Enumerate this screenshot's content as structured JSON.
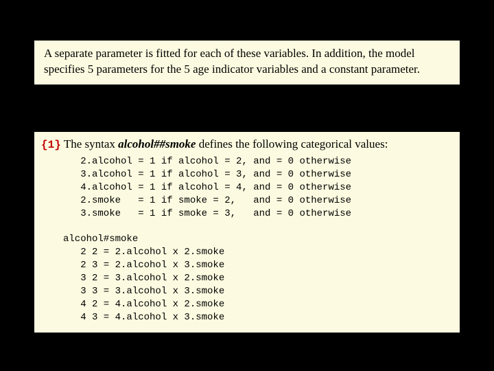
{
  "box1": {
    "text": "A separate parameter is fitted for each of these variables.  In addition, the model specifies 5 parameters for the 5 age indicator variables and a constant parameter."
  },
  "box2": {
    "marker": "{1}",
    "intro_before": "The syntax ",
    "intro_term": "alcohol##smoke",
    "intro_after": " defines the following categorical values:",
    "code": "   2.alcohol = 1 if alcohol = 2, and = 0 otherwise\n   3.alcohol = 1 if alcohol = 3, and = 0 otherwise\n   4.alcohol = 1 if alcohol = 4, and = 0 otherwise\n   2.smoke   = 1 if smoke = 2,   and = 0 otherwise\n   3.smoke   = 1 if smoke = 3,   and = 0 otherwise\n\nalcohol#smoke\n   2 2 = 2.alcohol x 2.smoke\n   2 3 = 2.alcohol x 3.smoke\n   3 2 = 3.alcohol x 2.smoke\n   3 3 = 3.alcohol x 3.smoke\n   4 2 = 4.alcohol x 2.smoke\n   4 3 = 4.alcohol x 3.smoke"
  }
}
